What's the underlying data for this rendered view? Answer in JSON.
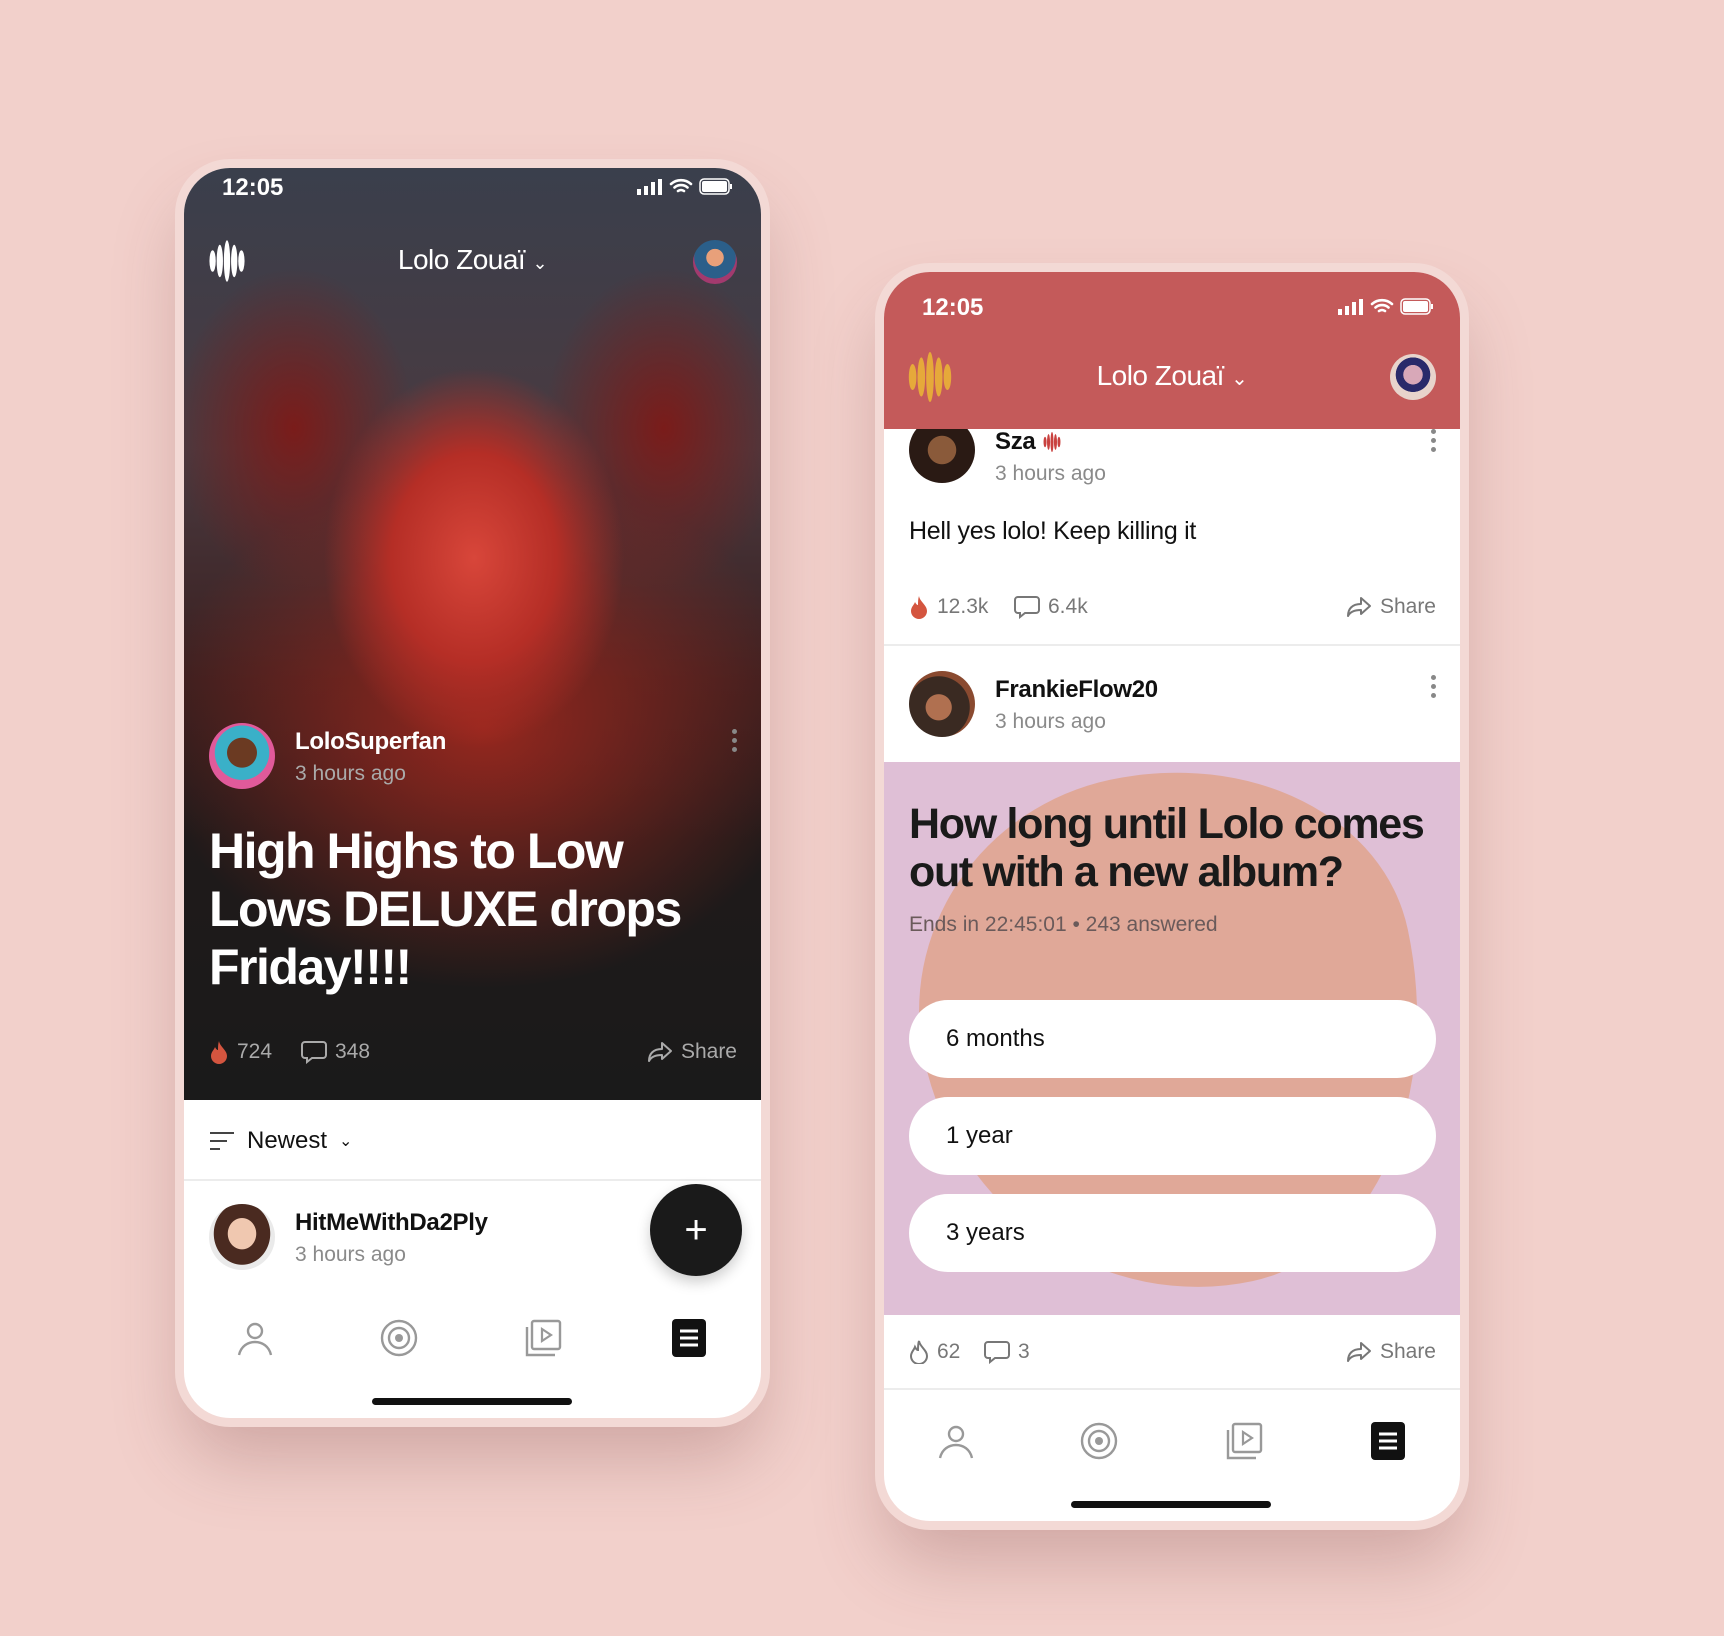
{
  "left_phone": {
    "status": {
      "time": "12:05"
    },
    "header": {
      "artist": "Lolo Zouaï"
    },
    "post": {
      "author": "LoloSuperfan",
      "time": "3 hours ago",
      "headline": [
        "High Highs to Low",
        "Lows DELUXE drops",
        "Friday!!!!"
      ],
      "likes": "724",
      "comments": "348",
      "share": "Share"
    },
    "sort": {
      "label": "Newest"
    },
    "comment": {
      "author": "HitMeWithDa2Ply",
      "time": "3 hours ago"
    },
    "nav": [
      "profile-icon",
      "target-icon",
      "video-icon",
      "feed-icon"
    ]
  },
  "right_phone": {
    "status": {
      "time": "12:05"
    },
    "header": {
      "artist": "Lolo Zouaï",
      "color": "#c45a5a",
      "logo_color": "#e6a93a"
    },
    "post1": {
      "author": "Sza",
      "verified": true,
      "time": "3 hours ago",
      "text": "Hell yes lolo! Keep killing it",
      "likes": "12.3k",
      "comments": "6.4k",
      "share": "Share"
    },
    "post2": {
      "author": "FrankieFlow20",
      "time": "3 hours ago",
      "poll": {
        "question": [
          "How long until Lolo comes",
          "out with a new album?"
        ],
        "ends_label": "Ends in",
        "ends_time": "22:45:01",
        "answered": "243 answered",
        "options": [
          "6 months",
          "1 year",
          "3 years"
        ]
      },
      "likes": "62",
      "comments": "3",
      "share": "Share"
    },
    "nav": [
      "profile-icon",
      "target-icon",
      "video-icon",
      "feed-icon"
    ]
  },
  "colors": {
    "background": "#f2d0cb",
    "accent": "#c45a5a",
    "poll_bg": "#dfbfd6",
    "poll_blob": "#e0a898"
  }
}
